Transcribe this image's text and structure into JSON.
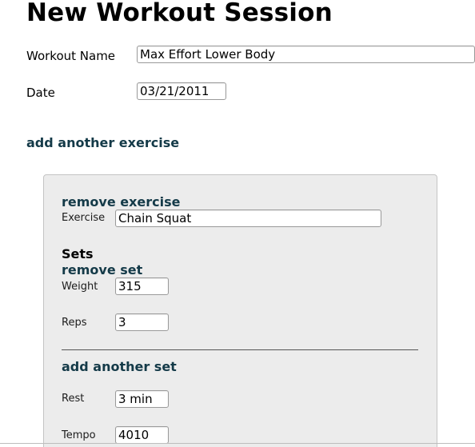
{
  "page": {
    "title": "New Workout Session"
  },
  "form": {
    "workout_name_label": "Workout Name",
    "workout_name_value": "Max Effort Lower Body",
    "date_label": "Date",
    "date_value": "03/21/2011",
    "add_exercise_link": "add another exercise"
  },
  "exercise": {
    "remove_exercise_link": "remove exercise",
    "exercise_label": "Exercise",
    "exercise_value": "Chain Squat",
    "sets_heading": "Sets",
    "remove_set_link": "remove set",
    "weight_label": "Weight",
    "weight_value": "315",
    "reps_label": "Reps",
    "reps_value": "3",
    "add_set_link": "add another set",
    "rest_label": "Rest",
    "rest_value": "3 min",
    "tempo_label": "Tempo",
    "tempo_value": "4010"
  },
  "colors": {
    "link": "#143a48",
    "panel_background": "#ececec"
  }
}
